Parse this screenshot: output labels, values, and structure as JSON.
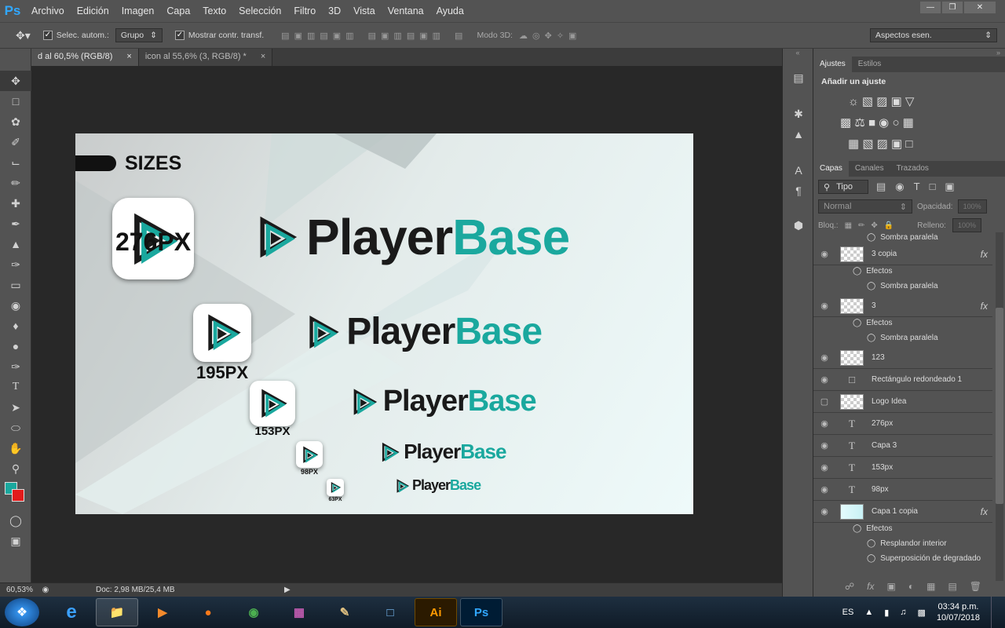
{
  "app": {
    "logo": "Ps"
  },
  "menu": [
    "Archivo",
    "Edición",
    "Imagen",
    "Capa",
    "Texto",
    "Selección",
    "Filtro",
    "3D",
    "Vista",
    "Ventana",
    "Ayuda"
  ],
  "options": {
    "auto_select": "Selec. autom.:",
    "group": "Grupo",
    "show_transform": "Mostrar contr. transf.",
    "mode3d": "Modo 3D:",
    "workspace": "Aspectos esen."
  },
  "tabs": [
    {
      "label": "d al 60,5% (RGB/8)",
      "close": "×"
    },
    {
      "label": "icon al 55,6% (3, RGB/8) *",
      "close": "×"
    }
  ],
  "canvas": {
    "header": "SIZES",
    "brand_a": "Player",
    "brand_b": "Base",
    "labels": [
      "276PX",
      "195PX",
      "153PX",
      "98PX",
      "63PX"
    ],
    "colors": {
      "teal": "#1aa89e",
      "dark": "#1a1a1a"
    }
  },
  "status": {
    "zoom": "60,53%",
    "doc": "Doc: 2,98 MB/25,4 MB"
  },
  "adjust": {
    "tab1": "Ajustes",
    "tab2": "Estilos",
    "title": "Añadir un ajuste"
  },
  "layers_panel": {
    "tabs": [
      "Capas",
      "Canales",
      "Trazados"
    ],
    "kind": "Tipo",
    "blend": "Normal",
    "opacity_label": "Opacidad:",
    "opacity": "100%",
    "lock_label": "Bloq.:",
    "fill_label": "Relleno:",
    "fill": "100%",
    "top_sub": "Sombra paralela",
    "layers": [
      {
        "name": "3 copia",
        "type": "img",
        "fx": true,
        "sub": [
          "Efectos",
          "Sombra paralela"
        ]
      },
      {
        "name": "3",
        "type": "img",
        "fx": true,
        "sub": [
          "Efectos",
          "Sombra paralela"
        ]
      },
      {
        "name": "123",
        "type": "img"
      },
      {
        "name": "Rectángulo redondeado 1",
        "type": "shape"
      },
      {
        "name": "Logo Idea",
        "type": "img",
        "hidden": true
      },
      {
        "name": "276px",
        "type": "text"
      },
      {
        "name": "Capa 3",
        "type": "text"
      },
      {
        "name": "153px",
        "type": "text"
      },
      {
        "name": "98px",
        "type": "text"
      },
      {
        "name": "Capa 1 copia",
        "type": "grad",
        "fx": true,
        "sub": [
          "Efectos",
          "Resplandor interior",
          "Superposición de degradado"
        ]
      }
    ]
  },
  "taskbar": {
    "lang": "ES",
    "time": "03:34 p.m.",
    "date": "10/07/2018"
  }
}
